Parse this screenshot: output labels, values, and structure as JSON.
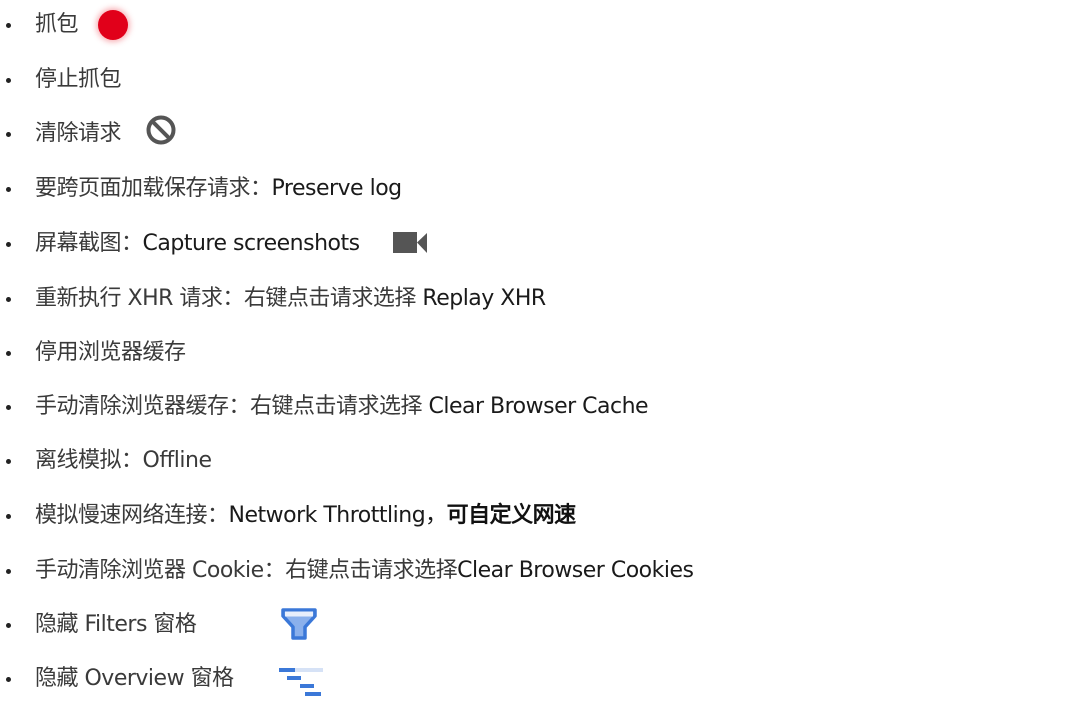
{
  "items": [
    {
      "segments": [
        "抓包"
      ],
      "icon": "record-icon",
      "icon_color": "#e1001a"
    },
    {
      "segments": [
        "停止抓包"
      ]
    },
    {
      "segments": [
        "清除请求"
      ],
      "icon": "clear-block-icon",
      "icon_color": "#555555"
    },
    {
      "segments": [
        "要跨页面加载保存请求：",
        "Preserve log"
      ]
    },
    {
      "segments": [
        "屏幕截图：",
        "Capture screenshots"
      ],
      "icon": "video-camera-icon",
      "icon_color": "#555555"
    },
    {
      "segments": [
        "重新执行 XHR 请求：右键点击请求选择 ",
        "Replay XHR"
      ]
    },
    {
      "segments": [
        "停用浏览器缓存"
      ]
    },
    {
      "segments": [
        "手动清除浏览器缓存：右键点击请求选择 ",
        "Clear Browser Cache"
      ]
    },
    {
      "segments": [
        "离线模拟：Offline"
      ]
    },
    {
      "segments": [
        "模拟慢速网络连接：",
        "Network Throttling，",
        "可自定义网速"
      ]
    },
    {
      "segments": [
        "手动清除浏览器 Cookie：右键点击请求选择",
        "Clear Browser Cookies"
      ]
    },
    {
      "segments": [
        "隐藏 Filters 窗格"
      ],
      "icon": "filter-icon",
      "icon_color": "#3b78d8"
    },
    {
      "segments": [
        "隐藏 Overview 窗格"
      ],
      "icon": "overview-icon",
      "icon_color": "#3b78d8"
    }
  ]
}
